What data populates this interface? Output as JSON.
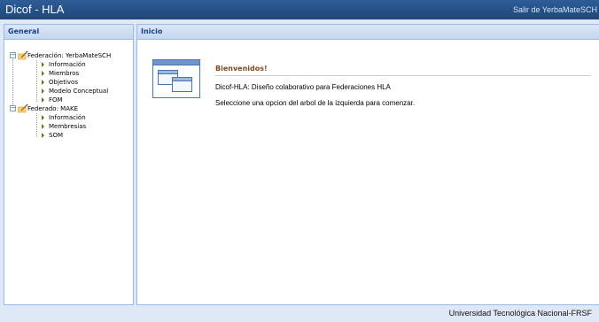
{
  "header": {
    "app_title": "Dicof - HLA",
    "logout_label": "Salir de YerbaMateSCH"
  },
  "west_panel": {
    "title": "General",
    "tree": [
      {
        "label": "Federación: YerbaMateSCH",
        "icon": "folder-edit-icon",
        "expanded": true,
        "children": [
          "Información",
          "Miembros",
          "Objetivos",
          "Modelo Conceptual",
          "FOM"
        ]
      },
      {
        "label": "Federado: MAKE",
        "icon": "folder-edit-icon",
        "expanded": true,
        "children": [
          "Información",
          "Membresías",
          "SOM"
        ]
      }
    ]
  },
  "center_panel": {
    "title": "Inicio",
    "welcome_title": "Bienvenidos!",
    "line1": "Dicof-HLA: Diseño colaborativo para Federaciones HLA",
    "line2": "Seleccione una opcion del arbol de la izquierda para comenzar."
  },
  "footer": {
    "text": "Universidad Tecnológica Nacional-FRSF"
  },
  "colors": {
    "header_bg": "#2f5d98",
    "panel_border": "#99bbe8",
    "panel_title": "#15428b",
    "welcome_title": "#7a4a20",
    "leaf_arrow": "#5a7a1a"
  }
}
